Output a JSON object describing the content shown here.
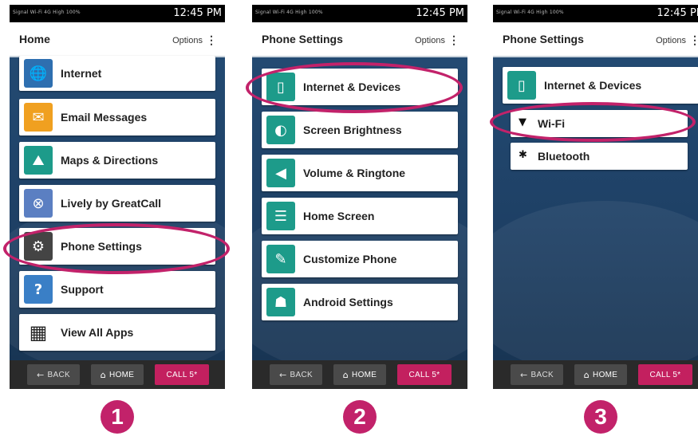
{
  "status": {
    "small": "Signal  Wi-Fi  4G  High  100%",
    "time": "12:45 PM"
  },
  "screens": [
    {
      "header": {
        "title": "Home",
        "options": "Options"
      },
      "items": [
        {
          "label": "Internet",
          "icon": "globe-icon",
          "icon_glyph": "🌐",
          "color": "#2e6fb0"
        },
        {
          "label": "Email Messages",
          "icon": "envelope-icon",
          "icon_glyph": "✉",
          "color": "#f0a020"
        },
        {
          "label": "Maps & Directions",
          "icon": "map-icon",
          "icon_glyph": "⛰",
          "color": "#1d9b8a"
        },
        {
          "label": "Lively by GreatCall",
          "icon": "lively-icon",
          "icon_glyph": "⊗",
          "color": "#5b7fc2"
        },
        {
          "label": "Phone Settings",
          "icon": "gear-icon",
          "icon_glyph": "⚙",
          "color": "#444444"
        },
        {
          "label": "Support",
          "icon": "question-icon",
          "icon_glyph": "?",
          "color": "#3a7fc6"
        },
        {
          "label": "View All Apps",
          "icon": "grid-icon",
          "icon_glyph": "▦",
          "color": "#222222"
        }
      ]
    },
    {
      "header": {
        "title": "Phone Settings",
        "options": "Options"
      },
      "items": [
        {
          "label": "Internet & Devices",
          "icon": "phone-signal-icon",
          "icon_glyph": "📱",
          "color": "#1d9b8a"
        },
        {
          "label": "Screen Brightness",
          "icon": "brightness-icon",
          "icon_glyph": "◐",
          "color": "#1d9b8a"
        },
        {
          "label": "Volume & Ringtone",
          "icon": "speaker-icon",
          "icon_glyph": "🔊",
          "color": "#1d9b8a"
        },
        {
          "label": "Home Screen",
          "icon": "list-icon",
          "icon_glyph": "☰",
          "color": "#1d9b8a"
        },
        {
          "label": "Customize Phone",
          "icon": "magic-wand-icon",
          "icon_glyph": "✎",
          "color": "#1d9b8a"
        },
        {
          "label": "Android Settings",
          "icon": "android-icon",
          "icon_glyph": "☗",
          "color": "#1d9b8a"
        }
      ]
    },
    {
      "header": {
        "title": "Phone Settings",
        "options": "Options"
      },
      "items": [
        {
          "label": "Internet & Devices",
          "icon": "phone-signal-icon",
          "icon_glyph": "📱",
          "color": "#1d9b8a"
        }
      ],
      "subitems": [
        {
          "label": "Wi-Fi",
          "icon": "wifi-icon",
          "icon_glyph": "▼"
        },
        {
          "label": "Bluetooth",
          "icon": "bluetooth-icon",
          "icon_glyph": "✱"
        }
      ]
    }
  ],
  "nav": {
    "back": "BACK",
    "home": "HOME",
    "call": "CALL 5*"
  },
  "steps": [
    "1",
    "2",
    "3"
  ],
  "colors": {
    "accent": "#c2226a",
    "teal": "#1d9b8a",
    "background": "#1d3a5c"
  }
}
